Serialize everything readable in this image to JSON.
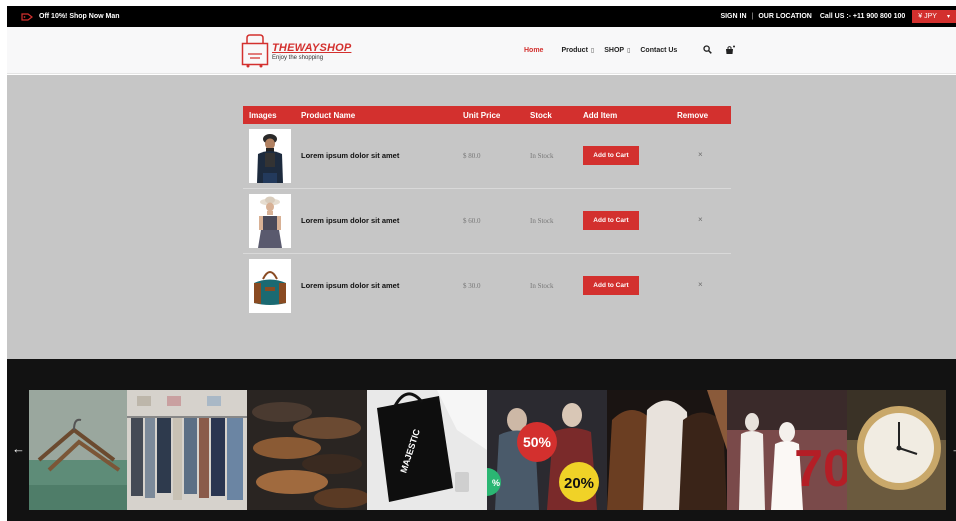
{
  "topbar": {
    "promo_text": "Off 10%! Shop Now Man",
    "sign_in": "SIGN IN",
    "separator": "|",
    "our_location": "OUR LOCATION",
    "call_us": "Call US :- +11 900 800 100",
    "currency": "¥ JPY",
    "currency_caret": "▾"
  },
  "brand": {
    "name": "THEWAYSHOP",
    "tagline": "Enjoy the shopping",
    "accent_color": "#d3302e"
  },
  "nav": {
    "home": "Home",
    "product": "Product",
    "shop": "SHOP",
    "contact": "Contact Us",
    "dropdown_glyph": "▯",
    "search_icon": "search-icon",
    "cart_icon": "shopping-bag-icon"
  },
  "cart": {
    "headers": {
      "images": "Images",
      "product_name": "Product Name",
      "unit_price": "Unit Price",
      "stock": "Stock",
      "add_item": "Add Item",
      "remove": "Remove"
    },
    "rows": [
      {
        "name": "Lorem ipsum dolor sit amet",
        "price": "$ 80.0",
        "stock": "In Stock",
        "button": "Add to Cart",
        "remove": "×"
      },
      {
        "name": "Lorem ipsum dolor sit amet",
        "price": "$ 60.0",
        "stock": "In Stock",
        "button": "Add to Cart",
        "remove": "×"
      },
      {
        "name": "Lorem ipsum dolor sit amet",
        "price": "$ 30.0",
        "stock": "In Stock",
        "button": "Add to Cart",
        "remove": "×"
      }
    ]
  },
  "gallery": {
    "prev": "←",
    "next": "→",
    "tiles": [
      "hangers",
      "clothing-rack",
      "shoes",
      "tote-bag",
      "mannequins-sale",
      "fur-coats",
      "mannequins-70",
      "watch"
    ],
    "tote_text": "MAJESTIC",
    "sale_50": "50%",
    "sale_20": "20%",
    "sale_percent_side": "%",
    "sale_70": "70"
  }
}
